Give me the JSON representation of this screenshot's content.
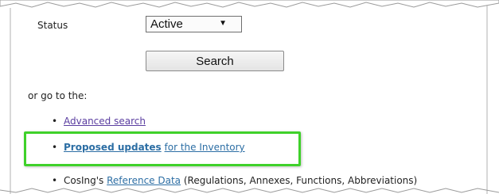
{
  "status": {
    "label": "Status",
    "selected": "Active"
  },
  "search": {
    "button_label": "Search"
  },
  "goto": {
    "text": "or go to the:"
  },
  "links": {
    "advanced": "Advanced search",
    "proposed_bold": "Proposed updates",
    "proposed_rest": "for the Inventory",
    "cosing_prefix": "CosIng's",
    "reference_data": "Reference Data",
    "reference_suffix": "(Regulations, Annexes, Functions, Abbreviations)"
  },
  "highlight_color": "#3fd12a",
  "bullet_glyph": "•"
}
